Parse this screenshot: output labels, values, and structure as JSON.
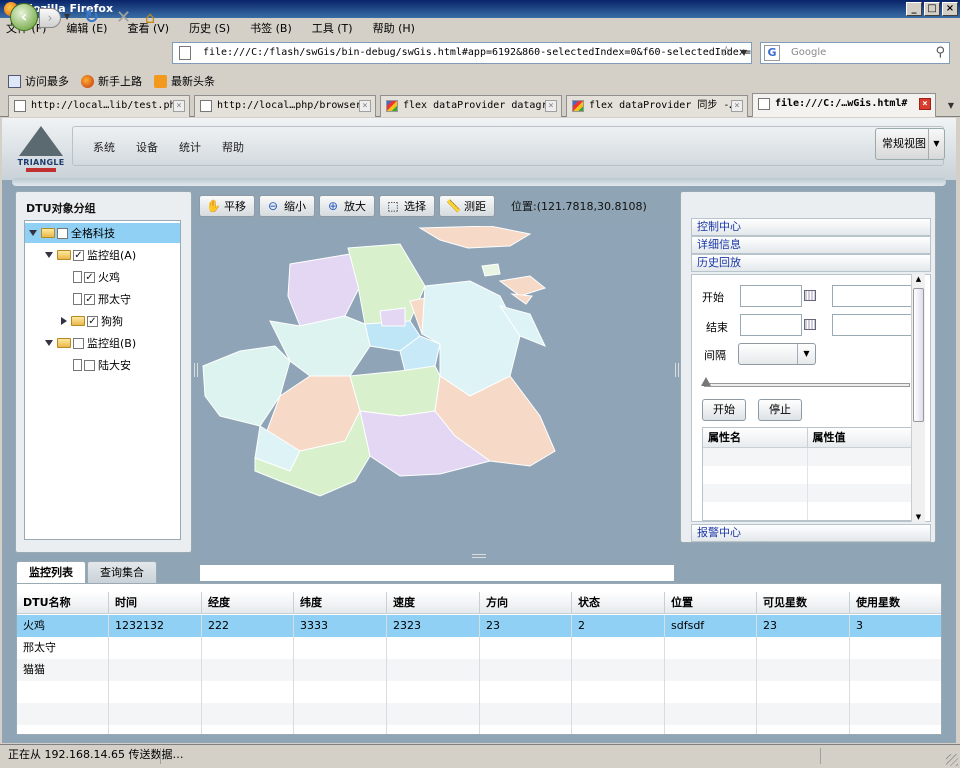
{
  "window": {
    "title": "Mozilla Firefox"
  },
  "menu": [
    "文件 (F)",
    "编辑 (E)",
    "查看 (V)",
    "历史 (S)",
    "书签 (B)",
    "工具 (T)",
    "帮助 (H)"
  ],
  "navbar": {
    "url": "file:///C:/flash/swGis/bin-debug/swGis.html#app=6192&860-selectedIndex=0&f60-selectedIndex=2",
    "search_placeholder": "Google"
  },
  "bookmarks": [
    "访问最多",
    "新手上路",
    "最新头条"
  ],
  "tabs": [
    {
      "label": "http://local…lib/test.php",
      "icon": "page"
    },
    {
      "label": "http://local…php/browser/",
      "icon": "page"
    },
    {
      "label": "flex dataProvider datagr…",
      "icon": "google"
    },
    {
      "label": "flex dataProvider 同步 -…",
      "icon": "google"
    },
    {
      "label": "file:///C:/…wGis.html#",
      "icon": "page",
      "active": true
    }
  ],
  "app": {
    "logo_text": "TRIANGLE",
    "nav_items": [
      "系统",
      "设备",
      "统计",
      "帮助"
    ],
    "view_button": "常规视图"
  },
  "left_panel": {
    "title": "DTU对象分组",
    "tree": [
      {
        "label": "全格科技",
        "level": 0,
        "expander": "open",
        "icon": "folder",
        "checked": false,
        "selected": true
      },
      {
        "label": "监控组(A)",
        "level": 1,
        "expander": "open",
        "icon": "folder",
        "checked": true
      },
      {
        "label": "火鸡",
        "level": 2,
        "expander": "none",
        "icon": "doc",
        "checked": true
      },
      {
        "label": "邢太守",
        "level": 2,
        "expander": "none",
        "icon": "doc",
        "checked": true
      },
      {
        "label": "狗狗",
        "level": 2,
        "expander": "closed",
        "icon": "folder",
        "checked": true
      },
      {
        "label": "监控组(B)",
        "level": 1,
        "expander": "open",
        "icon": "folder",
        "checked": false
      },
      {
        "label": "陆大安",
        "level": 2,
        "expander": "none",
        "icon": "doc",
        "checked": false
      }
    ]
  },
  "map": {
    "tools": [
      {
        "label": "平移",
        "icon": "hand-icon"
      },
      {
        "label": "缩小",
        "icon": "zoom-out-icon"
      },
      {
        "label": "放大",
        "icon": "zoom-in-icon"
      },
      {
        "label": "选择",
        "icon": "select-icon"
      },
      {
        "label": "测距",
        "icon": "ruler-icon"
      }
    ],
    "position_label": "位置:(121.7818,30.8108)"
  },
  "right_panel": {
    "sections": [
      "控制中心",
      "详细信息",
      "历史回放"
    ],
    "footer_section": "报警中心",
    "start_label": "开始",
    "end_label": "结束",
    "interval_label": "间隔",
    "start_button": "开始",
    "stop_button": "停止",
    "prop_headers": [
      "属性名",
      "属性值"
    ]
  },
  "bottom": {
    "tabs": [
      "监控列表",
      "查询集合"
    ],
    "columns": [
      "DTU名称",
      "时间",
      "经度",
      "纬度",
      "速度",
      "方向",
      "状态",
      "位置",
      "可见星数",
      "使用星数"
    ],
    "rows": [
      [
        "火鸡",
        "1232132",
        "222",
        "3333",
        "2323",
        "23",
        "2",
        "sdfsdf",
        "23",
        "3"
      ],
      [
        "邢太守",
        "",
        "",
        "",
        "",
        "",
        "",
        "",
        "",
        ""
      ],
      [
        "猫猫",
        "",
        "",
        "",
        "",
        "",
        "",
        "",
        "",
        ""
      ],
      [
        "",
        "",
        "",
        "",
        "",
        "",
        "",
        "",
        "",
        ""
      ],
      [
        "",
        "",
        "",
        "",
        "",
        "",
        "",
        "",
        "",
        ""
      ]
    ]
  },
  "status_bar": {
    "text": "正在从 192.168.14.65 传送数据…"
  },
  "colors": {
    "selection": "#8fd0f4",
    "accent_link": "#1a37a6"
  }
}
